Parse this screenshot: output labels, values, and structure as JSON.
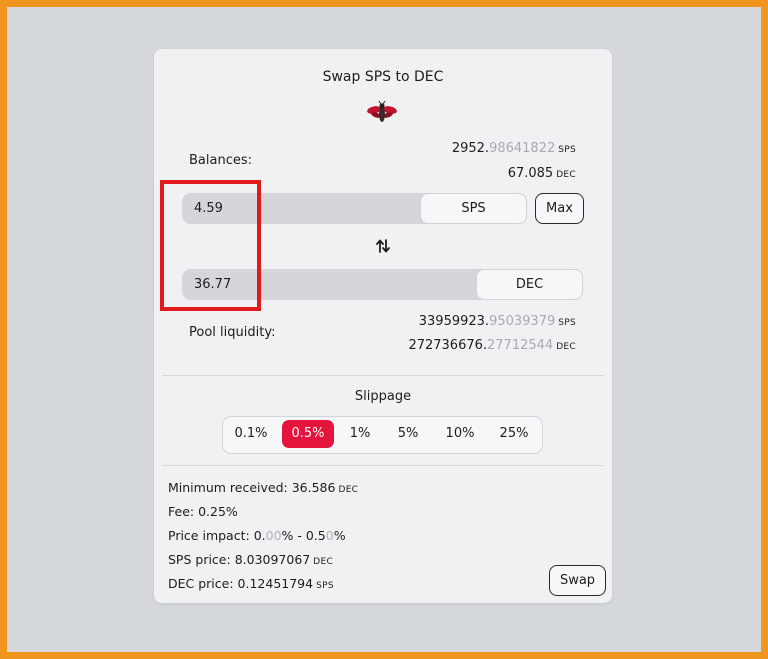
{
  "title": "Swap SPS to DEC",
  "balances": {
    "label": "Balances:",
    "sps_int": "2952.",
    "sps_frac": "98641822",
    "sps_unit": "SPS",
    "dec_value": "67.085",
    "dec_unit": "DEC"
  },
  "from": {
    "value": "4.59",
    "token": "SPS",
    "max_label": "Max"
  },
  "to": {
    "value": "36.77",
    "token": "DEC"
  },
  "pool": {
    "label": "Pool liquidity:",
    "sps_int": "33959923.",
    "sps_frac": "95039379",
    "sps_unit": "SPS",
    "dec_int": "272736676.",
    "dec_frac": "27712544",
    "dec_unit": "DEC"
  },
  "slippage": {
    "title": "Slippage",
    "options": [
      "0.1%",
      "0.5%",
      "1%",
      "5%",
      "10%",
      "25%"
    ],
    "selected": "0.5%"
  },
  "details": {
    "min_received_label": "Minimum received:",
    "min_received_value": "36.586",
    "min_received_unit": "DEC",
    "fee": "Fee: 0.25%",
    "price_impact_label": "Price impact:",
    "pi_a": "0.",
    "pi_b": "00",
    "pi_c": "% - 0.5",
    "pi_d": "0",
    "pi_e": "%",
    "sps_price_label": "SPS price:",
    "sps_price_value": "8.03097067",
    "sps_price_unit": "DEC",
    "dec_price_label": "DEC price:",
    "dec_price_value": "0.12451794",
    "dec_price_unit": "SPS"
  },
  "swap_label": "Swap",
  "colors": {
    "accent": "#e4143c",
    "highlight": "#e01a1a",
    "frame": "#f0961e"
  }
}
